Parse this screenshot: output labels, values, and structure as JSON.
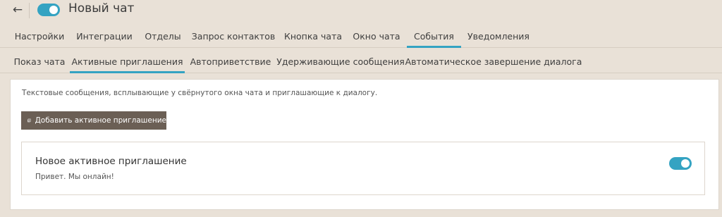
{
  "header": {
    "back_icon": "←",
    "title": "Новый чат",
    "enabled": true
  },
  "tabs_primary": [
    {
      "label": "Настройки",
      "active": false
    },
    {
      "label": "Интеграции",
      "active": false
    },
    {
      "label": "Отделы",
      "active": false
    },
    {
      "label": "Запрос контактов",
      "active": false
    },
    {
      "label": "Кнопка чата",
      "active": false
    },
    {
      "label": "Окно чата",
      "active": false
    },
    {
      "label": "События",
      "active": true
    },
    {
      "label": "Уведомления",
      "active": false
    }
  ],
  "tabs_secondary": [
    {
      "label": "Показ чата",
      "active": false
    },
    {
      "label": "Активные приглашения",
      "active": true
    },
    {
      "label": "Автоприветствие",
      "active": false
    },
    {
      "label": "Удерживающие сообщения",
      "active": false
    },
    {
      "label": "Автоматическое завершение диалога",
      "active": false
    }
  ],
  "panel": {
    "description": "Текстовые сообщения, всплывающие у свёрнутого окна чата и приглашающие к диалогу.",
    "add_button_label": "Добавить активное приглашение"
  },
  "invitation": {
    "title": "Новое активное приглашение",
    "text": "Привет. Мы онлайн!",
    "enabled": true
  },
  "colors": {
    "accent": "#34a3c2",
    "background": "#e9e1d7",
    "button": "#6b5f55"
  }
}
